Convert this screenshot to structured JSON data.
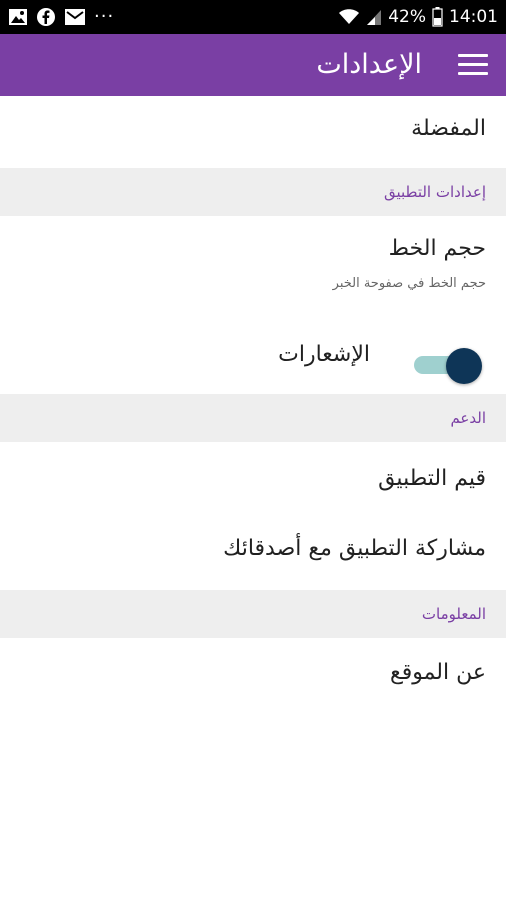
{
  "status_bar": {
    "battery": "42%",
    "time": "14:01",
    "left_icons": [
      "gallery-icon",
      "facebook-icon",
      "mail-icon"
    ],
    "more": "···"
  },
  "app_bar": {
    "title": "الإعدادات",
    "menu_icon": "hamburger-menu-icon",
    "color": "#7a3fa4"
  },
  "settings": {
    "favorites": "المفضلة",
    "app_settings_header": "إعدادات التطبيق",
    "font_size": {
      "title": "حجم الخط",
      "subtitle": "حجم الخط في صفوحة الخبر"
    },
    "notifications": {
      "label": "الإشعارات",
      "enabled": true
    },
    "support_header": "الدعم",
    "rate_app": "قيم التطبيق",
    "share_app": "مشاركة التطبيق مع أصدقائك",
    "info_header": "المعلومات",
    "about": "عن الموقع"
  }
}
